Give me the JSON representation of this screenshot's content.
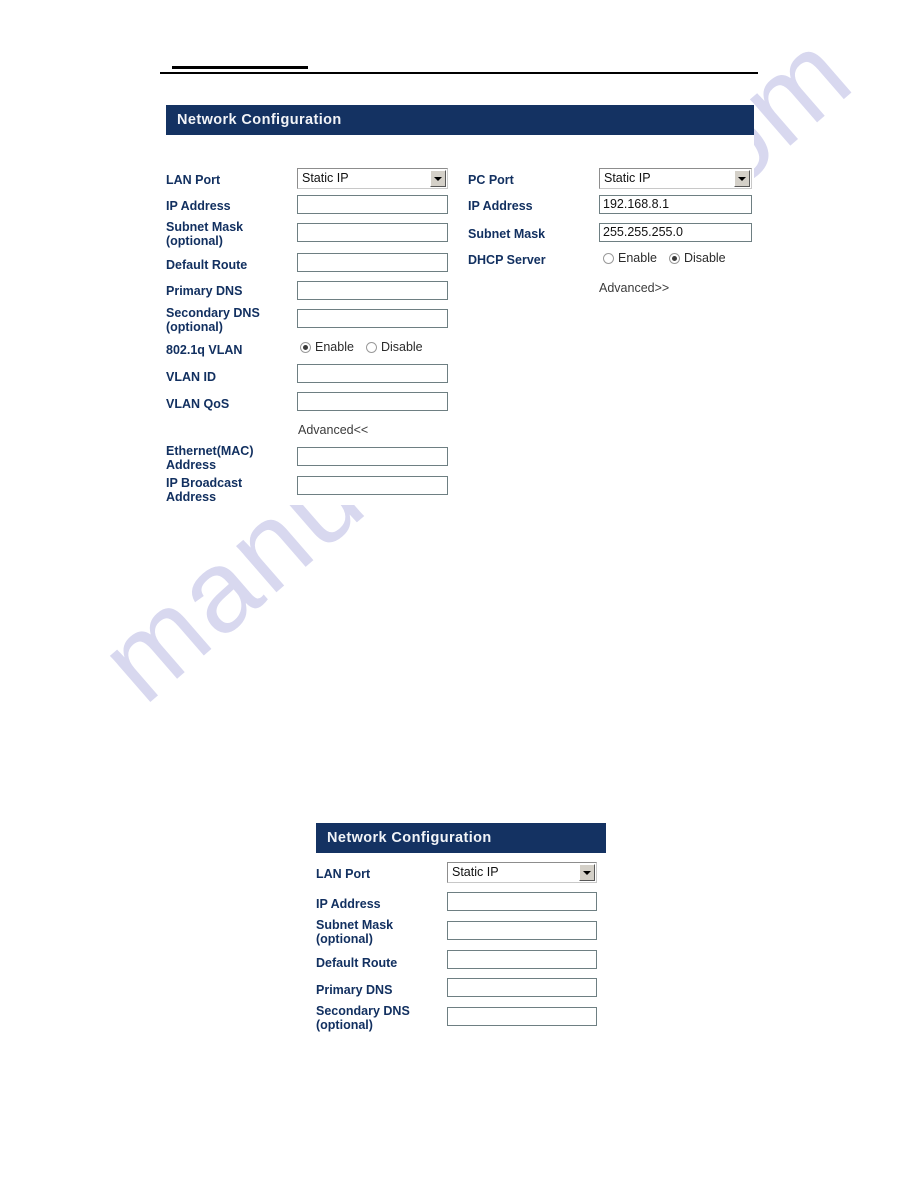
{
  "watermark": {
    "text": "manualshive.com"
  },
  "panel_one": {
    "title": "Network Configuration",
    "left_column": {
      "lan_port": {
        "label": "LAN Port",
        "value": "Static IP",
        "options": [
          "Static IP"
        ]
      },
      "ip_address": {
        "label": "IP Address",
        "value": ""
      },
      "subnet_mask": {
        "label": "Subnet Mask (optional)",
        "label_line1": "Subnet Mask",
        "label_line2": "(optional)",
        "value": ""
      },
      "default_route": {
        "label": "Default Route",
        "value": ""
      },
      "primary_dns": {
        "label": "Primary DNS",
        "value": ""
      },
      "secondary_dns": {
        "label": "Secondary DNS (optional)",
        "label_line1": "Secondary DNS",
        "label_line2": "(optional)",
        "value": ""
      },
      "vlan_8021q": {
        "label": "802.1q VLAN",
        "enable_label": "Enable",
        "disable_label": "Disable",
        "selected": "Enable"
      },
      "vlan_id": {
        "label": "VLAN ID",
        "value": ""
      },
      "vlan_qos": {
        "label": "VLAN QoS",
        "value": ""
      },
      "advanced_link": "Advanced<<",
      "ethernet_mac": {
        "label_line1": "Ethernet(MAC)",
        "label_line2": "Address",
        "value": ""
      },
      "ip_broadcast": {
        "label_line1": "IP Broadcast",
        "label_line2": "Address",
        "value": ""
      }
    },
    "right_column": {
      "pc_port": {
        "label": "PC Port",
        "value": "Static IP",
        "options": [
          "Static IP"
        ]
      },
      "ip_address": {
        "label": "IP Address",
        "value": "192.168.8.1"
      },
      "subnet_mask": {
        "label": "Subnet Mask",
        "value": "255.255.255.0"
      },
      "dhcp_server": {
        "label": "DHCP Server",
        "enable_label": "Enable",
        "disable_label": "Disable",
        "selected": "Disable"
      },
      "advanced_link": "Advanced>>"
    }
  },
  "panel_two": {
    "title": "Network Configuration",
    "fields": {
      "lan_port": {
        "label": "LAN Port",
        "value": "Static IP",
        "options": [
          "Static IP"
        ]
      },
      "ip_address": {
        "label": "IP Address",
        "value": ""
      },
      "subnet_mask": {
        "label_line1": "Subnet Mask",
        "label_line2": "(optional)",
        "value": ""
      },
      "default_route": {
        "label": "Default Route",
        "value": ""
      },
      "primary_dns": {
        "label": "Primary DNS",
        "value": ""
      },
      "secondary_dns": {
        "label_line1": "Secondary DNS",
        "label_line2": "(optional)",
        "value": ""
      }
    }
  },
  "colors": {
    "panel_header_bg": "#143262",
    "label_text": "#123060",
    "input_border": "#6e7f82",
    "watermark": "#d6d6ef"
  }
}
